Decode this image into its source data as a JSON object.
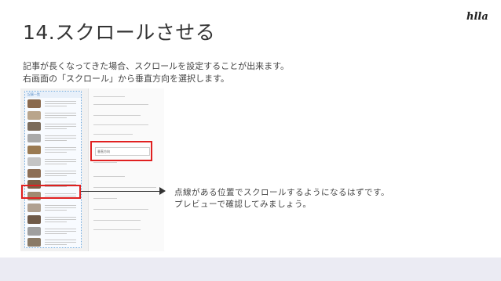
{
  "slide": {
    "title": "14.スクロールさせる",
    "logo": "hlla",
    "description": [
      "記事が長くなってきた場合、スクロールを設定することが出来ます。",
      "右画面の「スクロール」から垂直方向を選択します。"
    ],
    "note": [
      "点線がある位置でスクロールするようになるはずです。",
      "プレビューで確認してみましょう。"
    ]
  },
  "screenshot": {
    "phone_header": "記事一覧",
    "dropdown_value": "垂直方向",
    "thumb_colors": [
      "#8a6a4e",
      "#b9a58c",
      "#7b6b5a",
      "#a9a9a9",
      "#9a7a52",
      "#c4c4c4",
      "#8d6e55",
      "#7a5e44",
      "#a08a70",
      "#b0a090",
      "#6f5a48",
      "#9f9f9f",
      "#8a7a66"
    ]
  }
}
